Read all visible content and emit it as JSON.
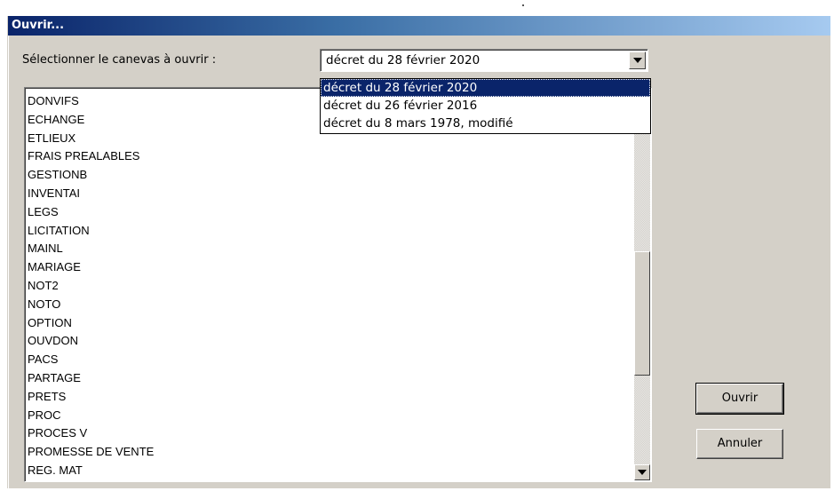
{
  "window": {
    "title": "Ouvrir..."
  },
  "selector": {
    "label": "Sélectionner le canevas à ouvrir :",
    "value": "décret du 28 février 2020",
    "options": [
      "décret du 28 février 2020",
      "décret du 26 février 2016",
      "décret du 8 mars 1978, modifié"
    ]
  },
  "list": {
    "items": [
      "DONVIFS",
      "ECHANGE",
      "ETLIEUX",
      "FRAIS PREALABLES",
      "GESTIONB",
      "INVENTAI",
      "LEGS",
      "LICITATION",
      "MAINL",
      "MARIAGE",
      "NOT2",
      "NOTO",
      "OPTION",
      "OUVDON",
      "PACS",
      "PARTAGE",
      "PRETS",
      "PROC",
      "PROCES V",
      "PROMESSE DE VENTE",
      "REG. MAT"
    ]
  },
  "buttons": {
    "open": "Ouvrir",
    "cancel": "Annuler"
  }
}
